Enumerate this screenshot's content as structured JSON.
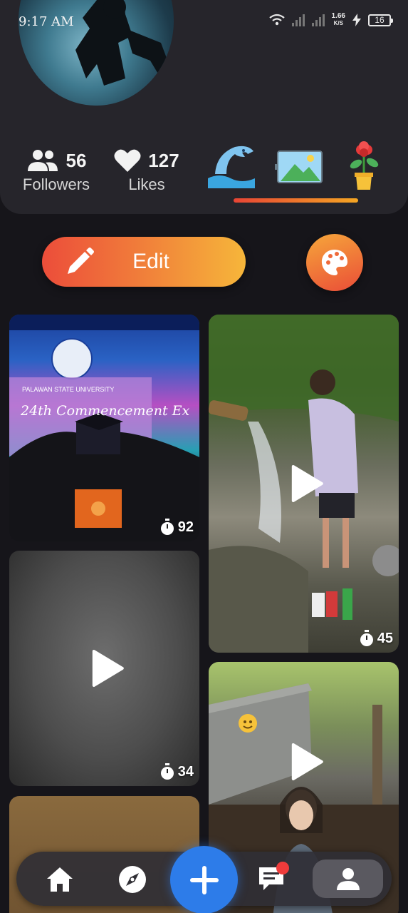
{
  "status_bar": {
    "time": "9:17 AM",
    "net_speed_value": "1.66",
    "net_speed_unit": "K/S",
    "battery": "16"
  },
  "profile": {
    "followers_count": "56",
    "followers_label": "Followers",
    "likes_count": "127",
    "likes_label": "Likes",
    "badges": [
      "dolphin-badge-icon",
      "landscape-badge-icon",
      "flower-pot-badge-icon"
    ]
  },
  "actions": {
    "edit_label": "Edit"
  },
  "grid": {
    "items": [
      {
        "kind": "photo",
        "duration": "92"
      },
      {
        "kind": "video",
        "duration": "45"
      },
      {
        "kind": "video",
        "duration": "34"
      },
      {
        "kind": "video"
      },
      {
        "kind": "video"
      }
    ],
    "graduation_text": {
      "university": "PALAWAN STATE UNIVERSITY",
      "event": "24th Commencement Ex"
    }
  },
  "nav": {
    "items": [
      "home-icon",
      "compass-icon",
      "add-icon",
      "messages-icon",
      "profile-icon"
    ]
  },
  "colors": {
    "accent_orange": "#f07a3a",
    "accent_red": "#ec4d3a",
    "accent_yellow": "#f6b63a",
    "fab_blue": "#2d7ce9",
    "notification_red": "#ef3b3b"
  }
}
